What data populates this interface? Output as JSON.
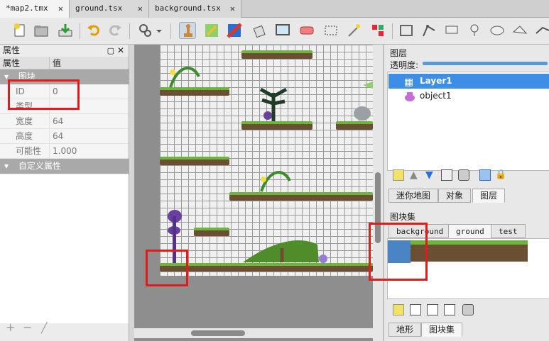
{
  "tabs": [
    {
      "label": "*map2.tmx"
    },
    {
      "label": "ground.tsx"
    },
    {
      "label": "background.tsx"
    }
  ],
  "properties": {
    "title": "属性",
    "col_name": "属性",
    "col_value": "值",
    "group": "图块",
    "rows": [
      {
        "key": "ID",
        "value": "0"
      },
      {
        "key": "类型",
        "value": ""
      },
      {
        "key": "宽度",
        "value": "64"
      },
      {
        "key": "高度",
        "value": "64"
      },
      {
        "key": "可能性",
        "value": "1.000"
      }
    ],
    "custom_group": "自定义属性"
  },
  "layers_panel": {
    "title": "图层",
    "opacity_label": "透明度:",
    "layers": [
      {
        "name": "Layer1"
      },
      {
        "name": "object1"
      }
    ],
    "tabs": [
      "迷你地图",
      "对象",
      "图层"
    ]
  },
  "tilesets_panel": {
    "title": "图块集",
    "tabs": [
      "background",
      "ground",
      "test"
    ],
    "bottom_tabs": [
      "地形",
      "图块集"
    ]
  }
}
